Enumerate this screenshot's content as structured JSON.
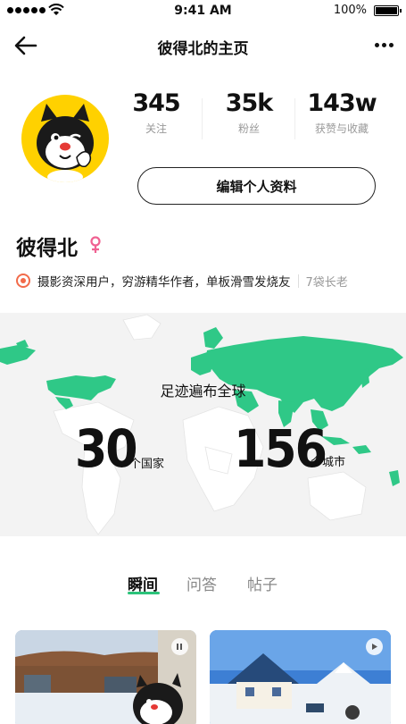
{
  "status_bar": {
    "time": "9:41 AM",
    "battery": "100%"
  },
  "nav": {
    "title": "彼得北的主页"
  },
  "stats": [
    {
      "value": "345",
      "label": "关注"
    },
    {
      "value": "35k",
      "label": "粉丝"
    },
    {
      "value": "143w",
      "label": "获赞与收藏"
    }
  ],
  "profile": {
    "edit_label": "编辑个人资料",
    "name": "彼得北",
    "tags": "摄影资深用户，穷游精华作者，单板滑雪发烧友",
    "level": "7袋长老"
  },
  "map": {
    "footprint": "足迹遍布全球",
    "countries": "30",
    "countries_unit": "个国家",
    "cities": "156",
    "cities_unit": "个城市"
  },
  "tabs": [
    {
      "label": "瞬间",
      "active": true
    },
    {
      "label": "问答",
      "active": false
    },
    {
      "label": "帖子",
      "active": false
    }
  ],
  "colors": {
    "accent": "#2bc37a",
    "avatar_bg": "#ffd100",
    "map_land": "#2fc887",
    "gender": "#f06292"
  },
  "icons": [
    "back-arrow-icon",
    "more-icon",
    "female-icon",
    "tag-badge-icon",
    "play-icon"
  ]
}
